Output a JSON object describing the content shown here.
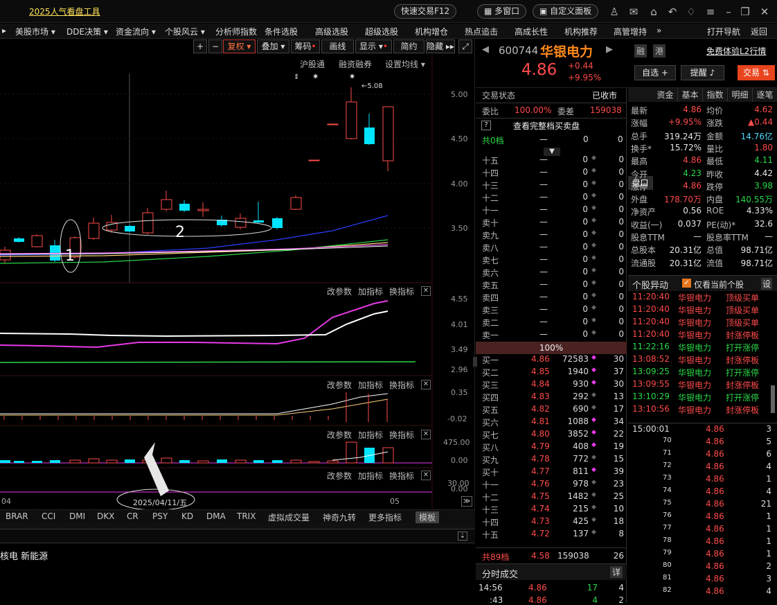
{
  "topbar": {
    "promo": "2025人气看盘工具",
    "quick_trade": "快速交易F12",
    "multi_window": "多窗口",
    "custom_panel": "自定义面板"
  },
  "menu": [
    "美股市场 ▾",
    "DDE决策 ▾",
    "资金流向 ▾",
    "个股风云 ▾",
    "分析师指数",
    "条件选股",
    "高级选股",
    "超级选股",
    "机构增仓",
    "热点追击",
    "高成长性",
    "机构推荐",
    "高管增持",
    "»",
    "打开导航",
    "返回"
  ],
  "toolbar": {
    "fq": "复权 ▾",
    "overlay": "叠加 ▾",
    "chips": "筹码",
    "draw": "画线",
    "display": "显示 ▾",
    "simple": "简约",
    "hide": "隐藏 ▸▸"
  },
  "chart": {
    "tags": [
      "沪股通",
      "融资融券",
      "设置均线 ▾"
    ],
    "high_label": "5.08",
    "y_ticks": [
      "5.00",
      "4.50",
      "4.00",
      "3.50"
    ],
    "annot1": "1",
    "annot2": "2",
    "sub_controls": [
      "改参数",
      "加指标",
      "换指标"
    ],
    "sub1_ticks": [
      "4.55",
      "4.01",
      "3.49",
      "2.96"
    ],
    "sub2_ticks": [
      "0.35",
      "-0.02"
    ],
    "sub3_ticks": [
      "475.00",
      "0.00"
    ],
    "sub4_ticks": [
      "30.00",
      "0.00"
    ],
    "x_left": "04",
    "x_date": "2025/04/11/五",
    "x_right": "05"
  },
  "indicator_tabs": [
    "BRAR",
    "CCI",
    "DMI",
    "DKX",
    "CR",
    "PSY",
    "KD",
    "DMA",
    "TRIX",
    "虚拟成交量",
    "神奇九转",
    "更多指标",
    "模板"
  ],
  "concepts": "核电  新能源",
  "stock": {
    "code": "600744",
    "name": "华银电力",
    "tag1": "融",
    "tag2": "港",
    "l2": "免费体验L2行情",
    "price": "4.86",
    "change": "+0.44",
    "pct": "+9.95%",
    "watch": "自选 +",
    "alert": "提醒",
    "trade": "交易"
  },
  "orderbook": {
    "status_label": "交易状态",
    "status": "已收市",
    "wb_label": "委比",
    "wb": "100.00%",
    "wc_label": "委差",
    "wc": "159038",
    "full_btn": "查看完整档买卖盘",
    "total_sell_label": "共0档",
    "total_sell_dash": "—",
    "total_sell_a": "0",
    "total_sell_b": "0",
    "sells": [
      [
        "十五",
        "—",
        "0",
        "0"
      ],
      [
        "十四",
        "—",
        "0",
        "0"
      ],
      [
        "十三",
        "—",
        "0",
        "0"
      ],
      [
        "十二",
        "—",
        "0",
        "0"
      ],
      [
        "十一",
        "—",
        "0",
        "0"
      ],
      [
        "卖十",
        "—",
        "0",
        "0"
      ],
      [
        "卖九",
        "—",
        "0",
        "0"
      ],
      [
        "卖八",
        "—",
        "0",
        "0"
      ],
      [
        "卖七",
        "—",
        "0",
        "0"
      ],
      [
        "卖六",
        "—",
        "0",
        "0"
      ],
      [
        "卖五",
        "—",
        "0",
        "0"
      ],
      [
        "卖四",
        "—",
        "0",
        "0"
      ],
      [
        "卖三",
        "—",
        "0",
        "0"
      ],
      [
        "卖二",
        "—",
        "0",
        "0"
      ],
      [
        "卖一",
        "—",
        "0",
        "0"
      ]
    ],
    "ratio": "100%",
    "buys": [
      [
        "买一",
        "4.86",
        "72583",
        "30"
      ],
      [
        "买二",
        "4.85",
        "1940",
        "37"
      ],
      [
        "买三",
        "4.84",
        "930",
        "30"
      ],
      [
        "买四",
        "4.83",
        "292",
        "13"
      ],
      [
        "买五",
        "4.82",
        "690",
        "17"
      ],
      [
        "买六",
        "4.81",
        "1088",
        "34"
      ],
      [
        "买七",
        "4.80",
        "3852",
        "22"
      ],
      [
        "买八",
        "4.79",
        "408",
        "19"
      ],
      [
        "买九",
        "4.78",
        "772",
        "15"
      ],
      [
        "买十",
        "4.77",
        "811",
        "39"
      ],
      [
        "十一",
        "4.76",
        "978",
        "23"
      ],
      [
        "十二",
        "4.75",
        "1482",
        "25"
      ],
      [
        "十三",
        "4.74",
        "215",
        "10"
      ],
      [
        "十四",
        "4.73",
        "425",
        "18"
      ],
      [
        "十五",
        "4.72",
        "137",
        "8"
      ]
    ],
    "total_buy": [
      "共89档",
      "4.58",
      "159038",
      "26"
    ],
    "ticks_label": "分时成交",
    "detail": "详",
    "tick1": [
      "14:56",
      "4.86",
      "17",
      "4"
    ],
    "tick2": [
      ":43",
      "4.86",
      "4",
      "2"
    ]
  },
  "tabs": [
    "盘口",
    "资金",
    "基本",
    "指数",
    "明细",
    "逐笔"
  ],
  "stats": [
    [
      "最新",
      "4.86",
      "均价",
      "4.62"
    ],
    [
      "涨幅",
      "+9.95%",
      "涨跌",
      "▲0.44"
    ],
    [
      "总手",
      "319.24万",
      "金额",
      "14.76亿"
    ],
    [
      "换手*",
      "15.72%",
      "量比",
      "1.80"
    ],
    [
      "最高",
      "4.86",
      "最低",
      "4.11"
    ],
    [
      "今开",
      "4.23",
      "昨收",
      "4.42"
    ],
    [
      "涨停",
      "4.86",
      "跌停",
      "3.98"
    ],
    [
      "外盘",
      "178.70万",
      "内盘",
      "140.55万"
    ],
    [
      "净资产",
      "0.56",
      "ROE",
      "4.33%"
    ],
    [
      "收益(一)",
      "0.037",
      "PE(动)*",
      "32.6"
    ],
    [
      "股息TTM",
      "—",
      "股息率TTM",
      "—"
    ],
    [
      "总股本",
      "20.31亿",
      "总值",
      "98.71亿"
    ],
    [
      "流通股",
      "20.31亿",
      "流值",
      "98.71亿"
    ]
  ],
  "moves": {
    "title": "个股异动",
    "only_current": "仅看当前个股",
    "settings": "设",
    "rows": [
      [
        "11:20:40",
        "华银电力",
        "顶级买单",
        "red"
      ],
      [
        "11:20:40",
        "华银电力",
        "顶级买单",
        "red"
      ],
      [
        "11:20:40",
        "华银电力",
        "顶级买单",
        "red"
      ],
      [
        "11:20:40",
        "华银电力",
        "封涨停板",
        "red"
      ],
      [
        "11:22:16",
        "华银电力",
        "打开涨停",
        "grn"
      ],
      [
        "13:08:52",
        "华银电力",
        "封涨停板",
        "red"
      ],
      [
        "13:09:25",
        "华银电力",
        "打开涨停",
        "grn"
      ],
      [
        "13:09:55",
        "华银电力",
        "封涨停板",
        "red"
      ],
      [
        "13:10:29",
        "华银电力",
        "打开涨停",
        "grn"
      ],
      [
        "13:10:56",
        "华银电力",
        "封涨停板",
        "red"
      ]
    ]
  },
  "trades": {
    "head": [
      "15:00:01",
      "4.86",
      "3"
    ],
    "rows": [
      [
        "70",
        "4.86",
        "5"
      ],
      [
        "71",
        "4.86",
        "6"
      ],
      [
        "72",
        "4.86",
        "4"
      ],
      [
        "73",
        "4.86",
        "1"
      ],
      [
        "74",
        "4.86",
        "4"
      ],
      [
        "75",
        "4.86",
        "21"
      ],
      [
        "76",
        "4.86",
        "1"
      ],
      [
        "77",
        "4.86",
        "1"
      ],
      [
        "78",
        "4.86",
        "1"
      ],
      [
        "79",
        "4.86",
        "1"
      ],
      [
        "80",
        "4.86",
        "2"
      ],
      [
        "81",
        "4.86",
        "3"
      ],
      [
        "82",
        "4.86",
        "4"
      ]
    ]
  }
}
